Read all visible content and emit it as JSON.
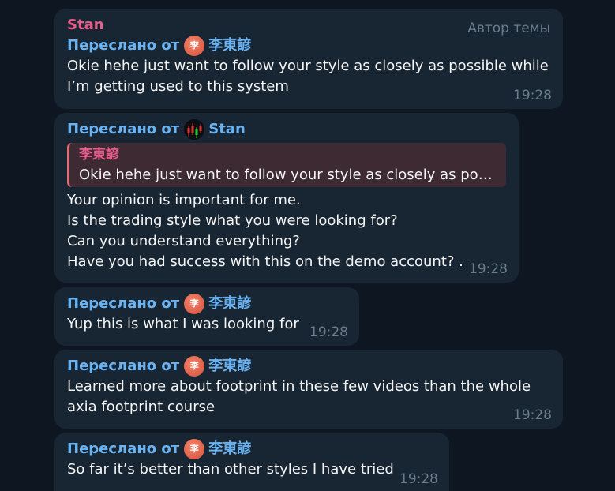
{
  "messages": [
    {
      "author": "Stan",
      "thread_label": "Автор темы",
      "forwarded_prefix": "Переслано от",
      "forwarded_from": "李東諺",
      "avatar_glyph": "李",
      "lines": [
        "Okie hehe just want to follow your style as closely as possible while",
        "I’m getting used to this system"
      ],
      "time": "19:28"
    },
    {
      "forwarded_prefix": "Переслано от",
      "forwarded_from": "Stan",
      "reply": {
        "author": "李東諺",
        "text": "Okie hehe just want to follow your style as closely as poss…"
      },
      "lines": [
        "Your opinion is important for me.",
        "Is the trading style what you were looking for?",
        "Can you understand everything?",
        "Have you had success with this on the demo account? ."
      ],
      "time": "19:28"
    },
    {
      "forwarded_prefix": "Переслано от",
      "forwarded_from": "李東諺",
      "avatar_glyph": "李",
      "lines": [
        "Yup this is what I was looking for"
      ],
      "time": "19:28"
    },
    {
      "forwarded_prefix": "Переслано от",
      "forwarded_from": "李東諺",
      "avatar_glyph": "李",
      "lines": [
        "Learned more about footprint in these few videos than the whole",
        "axia footprint course"
      ],
      "time": "19:28"
    },
    {
      "forwarded_prefix": "Переслано от",
      "forwarded_from": "李東諺",
      "avatar_glyph": "李",
      "lines": [
        "So far it’s better than other styles I have tried"
      ],
      "time": "19:28"
    }
  ]
}
